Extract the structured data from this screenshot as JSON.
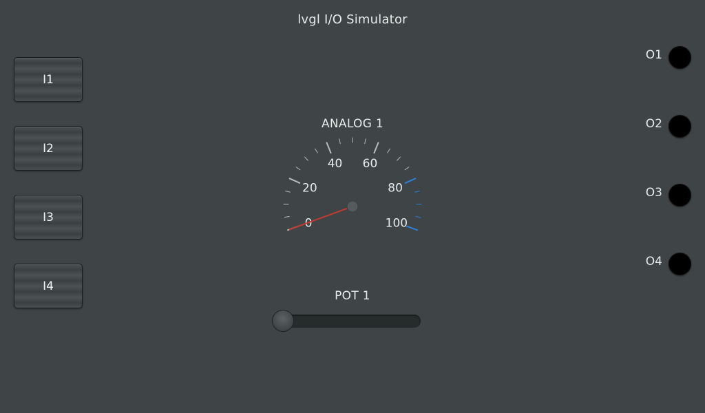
{
  "app": {
    "title": "lvgl I/O Simulator"
  },
  "inputs": [
    {
      "label": "I1"
    },
    {
      "label": "I2"
    },
    {
      "label": "I3"
    },
    {
      "label": "I4"
    }
  ],
  "outputs": [
    {
      "label": "O1",
      "state": "off",
      "led_color": "#000000"
    },
    {
      "label": "O2",
      "state": "off",
      "led_color": "#000000"
    },
    {
      "label": "O3",
      "state": "off",
      "led_color": "#000000"
    },
    {
      "label": "O4",
      "state": "off",
      "led_color": "#000000"
    }
  ],
  "gauge": {
    "title": "ANALOG 1",
    "min": 0,
    "max": 100,
    "value": 0,
    "scale_labels": [
      "0",
      "20",
      "40",
      "60",
      "80",
      "100"
    ],
    "critical_from": 80,
    "colors": {
      "tick": "#b8bcbc",
      "critical_tick": "#2d7fd8",
      "needle": "#c23b30",
      "hub": "#555b5c"
    }
  },
  "pot": {
    "title": "POT 1",
    "min": 0,
    "max": 100,
    "value": 0
  }
}
